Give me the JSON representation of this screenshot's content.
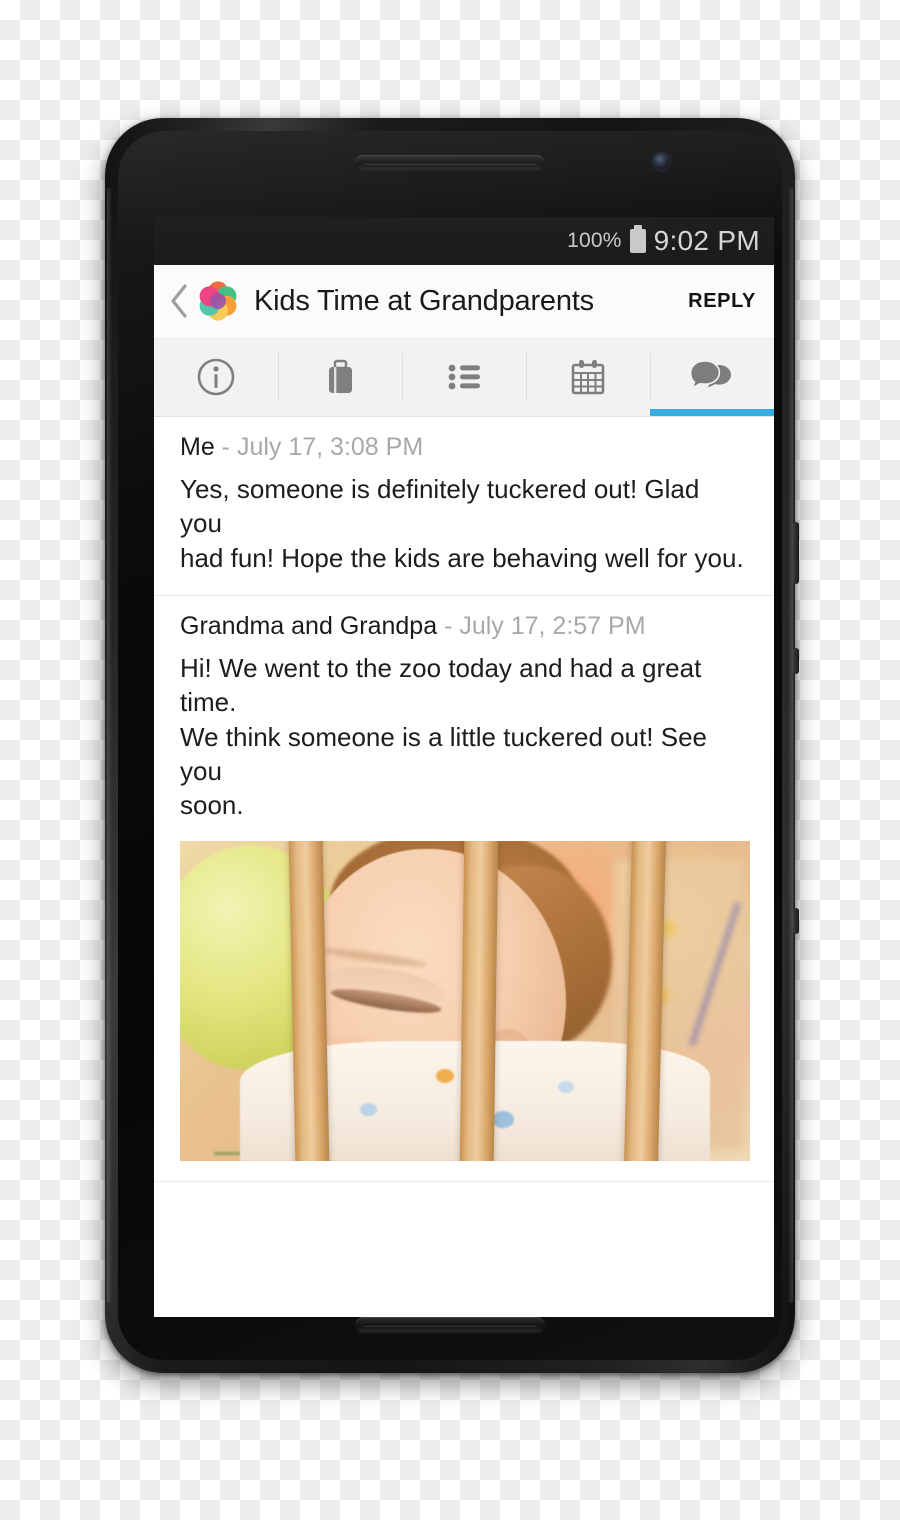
{
  "status_bar": {
    "battery_percent": "100%",
    "battery_icon": "battery-full-icon",
    "time": "9:02 PM"
  },
  "app_bar": {
    "back_icon": "chevron-left-icon",
    "logo_icon": "app-logo-flower-icon",
    "title": "Kids Time at Grandparents",
    "reply_label": "REPLY"
  },
  "tabs": [
    {
      "icon": "info-circle-icon",
      "name": "details",
      "active": false
    },
    {
      "icon": "briefcase-icon",
      "name": "packing",
      "active": false
    },
    {
      "icon": "list-icon",
      "name": "list",
      "active": false
    },
    {
      "icon": "calendar-icon",
      "name": "calendar",
      "active": false
    },
    {
      "icon": "chat-bubbles-icon",
      "name": "messages",
      "active": true
    }
  ],
  "accent_color": "#36aee0",
  "messages": [
    {
      "author": "Me",
      "separator": " - ",
      "time": "July 17, 3:08 PM",
      "body": "Yes, someone is definitely tuckered out!  Glad you\nhad fun!  Hope the kids are behaving well for you.",
      "has_photo": false
    },
    {
      "author": "Grandma and Grandpa",
      "separator": " - ",
      "time": "July 17, 2:57 PM",
      "body": "Hi!  We went to the zoo today and had a great time.\nWe think someone is a little tuckered out!  See you\nsoon.",
      "has_photo": true,
      "photo_alt": "Sleeping baby leaning against wooden crib slats with a green balloon"
    }
  ],
  "device": {
    "speaker_top": "speaker-grille-top",
    "speaker_bottom": "speaker-grille-bottom",
    "front_camera": "front-camera"
  }
}
